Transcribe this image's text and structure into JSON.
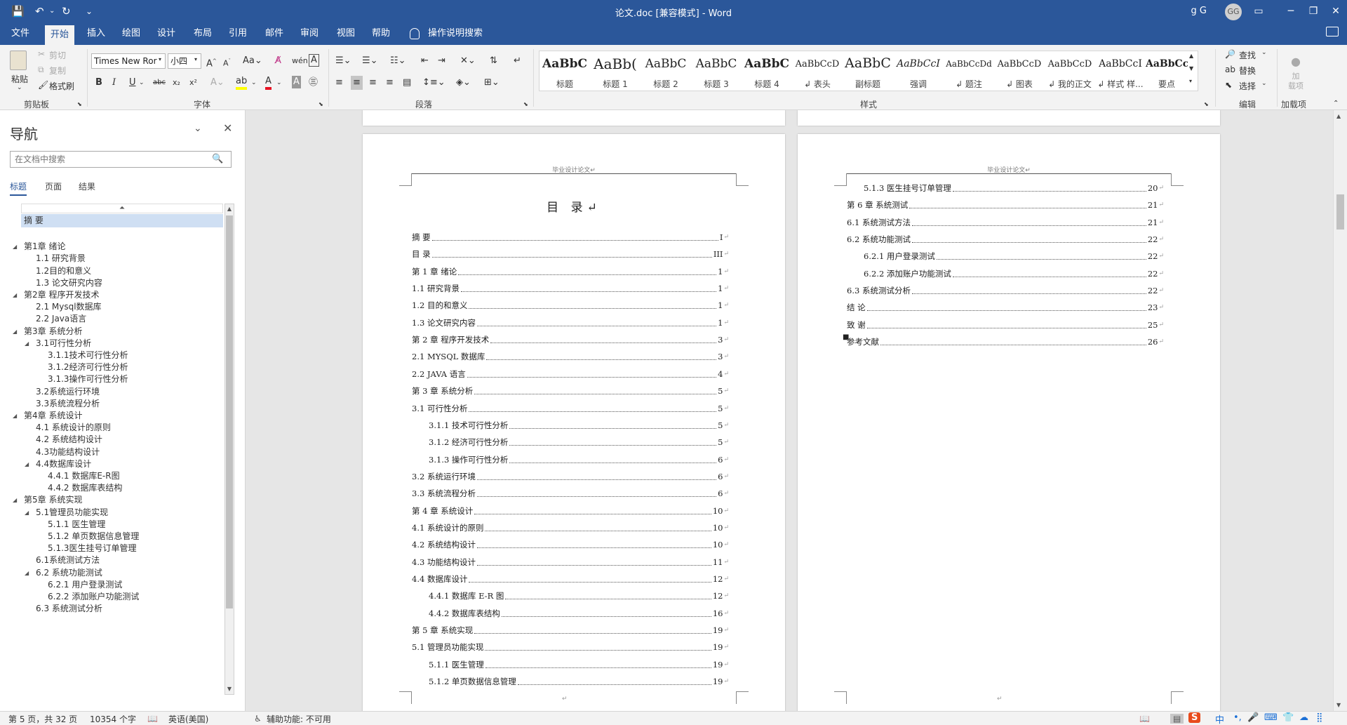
{
  "window": {
    "title": "论文.doc [兼容模式]  -  Word",
    "user": "g G",
    "avatar_initials": "GG",
    "accent_color": "#2b579a"
  },
  "quick_access": {
    "save_icon": "💾",
    "undo_icon": "↶",
    "redo_icon": "↻",
    "customize_icon": "⌄"
  },
  "tabs": [
    {
      "label": "文件"
    },
    {
      "label": "开始"
    },
    {
      "label": "插入"
    },
    {
      "label": "绘图"
    },
    {
      "label": "设计"
    },
    {
      "label": "布局"
    },
    {
      "label": "引用"
    },
    {
      "label": "邮件"
    },
    {
      "label": "审阅"
    },
    {
      "label": "视图"
    },
    {
      "label": "帮助"
    }
  ],
  "tell_me": "操作说明搜索",
  "ribbon": {
    "clipboard": {
      "paste": "粘贴",
      "cut": "剪切",
      "copy": "复制",
      "format_painter": "格式刷",
      "label": "剪贴板"
    },
    "font": {
      "font_name": "Times New Ror",
      "font_size": "小四",
      "label": "字体"
    },
    "paragraph": {
      "label": "段落"
    },
    "styles": {
      "label": "样式",
      "items": [
        {
          "preview": "AaBbC",
          "name": "标题"
        },
        {
          "preview": "AaBb(",
          "name": "标题 1"
        },
        {
          "preview": "AaBbC",
          "name": "标题 2"
        },
        {
          "preview": "AaBbC",
          "name": "标题 3"
        },
        {
          "preview": "AaBbC",
          "name": "标题 4"
        },
        {
          "preview": "AaBbCcD",
          "name": "↲ 表头"
        },
        {
          "preview": "AaBbC",
          "name": "副标题"
        },
        {
          "preview": "AaBbCcI",
          "name": "强调"
        },
        {
          "preview": "AaBbCcDd",
          "name": "↲ 题注"
        },
        {
          "preview": "AaBbCcD",
          "name": "↲ 图表"
        },
        {
          "preview": "AaBbCcD",
          "name": "↲ 我的正文"
        },
        {
          "preview": "AaBbCcI",
          "name": "↲ 样式 样..."
        },
        {
          "preview": "AaBbCcl",
          "name": "要点"
        }
      ]
    },
    "editing": {
      "find": "查找",
      "replace": "替换",
      "select": "选择",
      "label": "编辑"
    },
    "addins": {
      "button": "加\n载项",
      "label": "加载项"
    }
  },
  "nav": {
    "title": "导航",
    "search_placeholder": "在文档中搜索",
    "tabs": [
      "标题",
      "页面",
      "结果"
    ],
    "headings": [
      {
        "text": "摘  要",
        "level": 0,
        "toggle": "",
        "selected": true
      },
      {
        "text": "第1章 绪论",
        "level": 0,
        "toggle": "◢"
      },
      {
        "text": "1.1 研究背景",
        "level": 1,
        "toggle": ""
      },
      {
        "text": "1.2目的和意义",
        "level": 1,
        "toggle": ""
      },
      {
        "text": "1.3 论文研究内容",
        "level": 1,
        "toggle": ""
      },
      {
        "text": "第2章 程序开发技术",
        "level": 0,
        "toggle": "◢"
      },
      {
        "text": "2.1 Mysql数据库",
        "level": 1,
        "toggle": ""
      },
      {
        "text": "2.2 Java语言",
        "level": 1,
        "toggle": ""
      },
      {
        "text": "第3章 系统分析",
        "level": 0,
        "toggle": "◢"
      },
      {
        "text": "3.1可行性分析",
        "level": 1,
        "toggle": "◢"
      },
      {
        "text": "3.1.1技术可行性分析",
        "level": 2,
        "toggle": ""
      },
      {
        "text": "3.1.2经济可行性分析",
        "level": 2,
        "toggle": ""
      },
      {
        "text": "3.1.3操作可行性分析",
        "level": 2,
        "toggle": ""
      },
      {
        "text": "3.2系统运行环境",
        "level": 1,
        "toggle": ""
      },
      {
        "text": "3.3系统流程分析",
        "level": 1,
        "toggle": ""
      },
      {
        "text": "第4章 系统设计",
        "level": 0,
        "toggle": "◢"
      },
      {
        "text": "4.1 系统设计的原则",
        "level": 1,
        "toggle": ""
      },
      {
        "text": "4.2 系统结构设计",
        "level": 1,
        "toggle": ""
      },
      {
        "text": "4.3功能结构设计",
        "level": 1,
        "toggle": ""
      },
      {
        "text": "4.4数据库设计",
        "level": 1,
        "toggle": "◢"
      },
      {
        "text": "4.4.1 数据库E-R图",
        "level": 2,
        "toggle": ""
      },
      {
        "text": "4.4.2 数据库表结构",
        "level": 2,
        "toggle": ""
      },
      {
        "text": "第5章 系统实现",
        "level": 0,
        "toggle": "◢"
      },
      {
        "text": "5.1管理员功能实现",
        "level": 1,
        "toggle": "◢"
      },
      {
        "text": "5.1.1 医生管理",
        "level": 2,
        "toggle": ""
      },
      {
        "text": "5.1.2 单页数据信息管理",
        "level": 2,
        "toggle": ""
      },
      {
        "text": "5.1.3医生挂号订单管理",
        "level": 2,
        "toggle": ""
      },
      {
        "text": "6.1系统测试方法",
        "level": 1,
        "toggle": ""
      },
      {
        "text": "6.2 系统功能测试",
        "level": 1,
        "toggle": "◢"
      },
      {
        "text": "6.2.1 用户登录测试",
        "level": 2,
        "toggle": ""
      },
      {
        "text": "6.2.2 添加账户功能测试",
        "level": 2,
        "toggle": ""
      },
      {
        "text": "6.3 系统测试分析",
        "level": 1,
        "toggle": ""
      }
    ]
  },
  "document": {
    "header_text": "毕业设计论文↵",
    "toc_title": "目  录↵",
    "page_left_toc": [
      {
        "text": "摘    要",
        "page": "I",
        "indent": 0
      },
      {
        "text": "目    录",
        "page": "III",
        "indent": 0
      },
      {
        "text": "第 1 章  绪论",
        "page": "1",
        "indent": 0
      },
      {
        "text": "1.1  研究背景",
        "page": "1",
        "indent": 0
      },
      {
        "text": "1.2 目的和意义",
        "page": "1",
        "indent": 0
      },
      {
        "text": "1.3  论文研究内容",
        "page": "1",
        "indent": 0
      },
      {
        "text": "第 2 章  程序开发技术",
        "page": "3",
        "indent": 0
      },
      {
        "text": "2.1 MYSQL 数据库",
        "page": "3",
        "indent": 0
      },
      {
        "text": "2.2 JAVA 语言",
        "page": "4",
        "indent": 0
      },
      {
        "text": "第 3 章  系统分析",
        "page": "5",
        "indent": 0
      },
      {
        "text": "3.1 可行性分析",
        "page": "5",
        "indent": 0
      },
      {
        "text": "3.1.1  技术可行性分析",
        "page": "5",
        "indent": 1
      },
      {
        "text": "3.1.2  经济可行性分析",
        "page": "5",
        "indent": 1
      },
      {
        "text": "3.1.3  操作可行性分析",
        "page": "6",
        "indent": 1
      },
      {
        "text": "3.2 系统运行环境",
        "page": "6",
        "indent": 0
      },
      {
        "text": "3.3  系统流程分析",
        "page": "6",
        "indent": 0
      },
      {
        "text": "第 4 章  系统设计",
        "page": "10",
        "indent": 0
      },
      {
        "text": "4.1  系统设计的原则",
        "page": "10",
        "indent": 0
      },
      {
        "text": "4.2  系统结构设计",
        "page": "10",
        "indent": 0
      },
      {
        "text": "4.3 功能结构设计",
        "page": "11",
        "indent": 0
      },
      {
        "text": "4.4 数据库设计",
        "page": "12",
        "indent": 0
      },
      {
        "text": "4.4.1  数据库 E-R 图",
        "page": "12",
        "indent": 1
      },
      {
        "text": "4.4.2  数据库表结构",
        "page": "16",
        "indent": 1
      },
      {
        "text": "第 5 章  系统实现",
        "page": "19",
        "indent": 0
      },
      {
        "text": "5.1 管理员功能实现",
        "page": "19",
        "indent": 0
      },
      {
        "text": "5.1.1  医生管理",
        "page": "19",
        "indent": 1
      },
      {
        "text": "5.1.2  单页数据信息管理",
        "page": "19",
        "indent": 1
      }
    ],
    "page_right_toc": [
      {
        "text": "5.1.3 医生挂号订单管理",
        "page": "20",
        "indent": 1
      },
      {
        "text": "第 6 章  系统测试",
        "page": "21",
        "indent": 0
      },
      {
        "text": "6.1 系统测试方法",
        "page": "21",
        "indent": 0
      },
      {
        "text": "6.2  系统功能测试",
        "page": "22",
        "indent": 0
      },
      {
        "text": "6.2.1  用户登录测试",
        "page": "22",
        "indent": 1
      },
      {
        "text": "6.2.2  添加账户功能测试",
        "page": "22",
        "indent": 1
      },
      {
        "text": "6.3  系统测试分析",
        "page": "22",
        "indent": 0
      },
      {
        "text": "结    论",
        "page": "23",
        "indent": 0
      },
      {
        "text": "致    谢",
        "page": "25",
        "indent": 0
      },
      {
        "text": "参考文献",
        "page": "26",
        "indent": 0
      }
    ],
    "return_mark": "↵"
  },
  "status": {
    "page": "第 5 页，共 32 页",
    "words": "10354 个字",
    "language": "英语(美国)",
    "accessibility": "辅助功能: 不可用",
    "ime_chars": [
      "S",
      "中",
      "•,",
      "🎤",
      "⌨",
      "👕",
      "☁",
      "⣿"
    ]
  }
}
